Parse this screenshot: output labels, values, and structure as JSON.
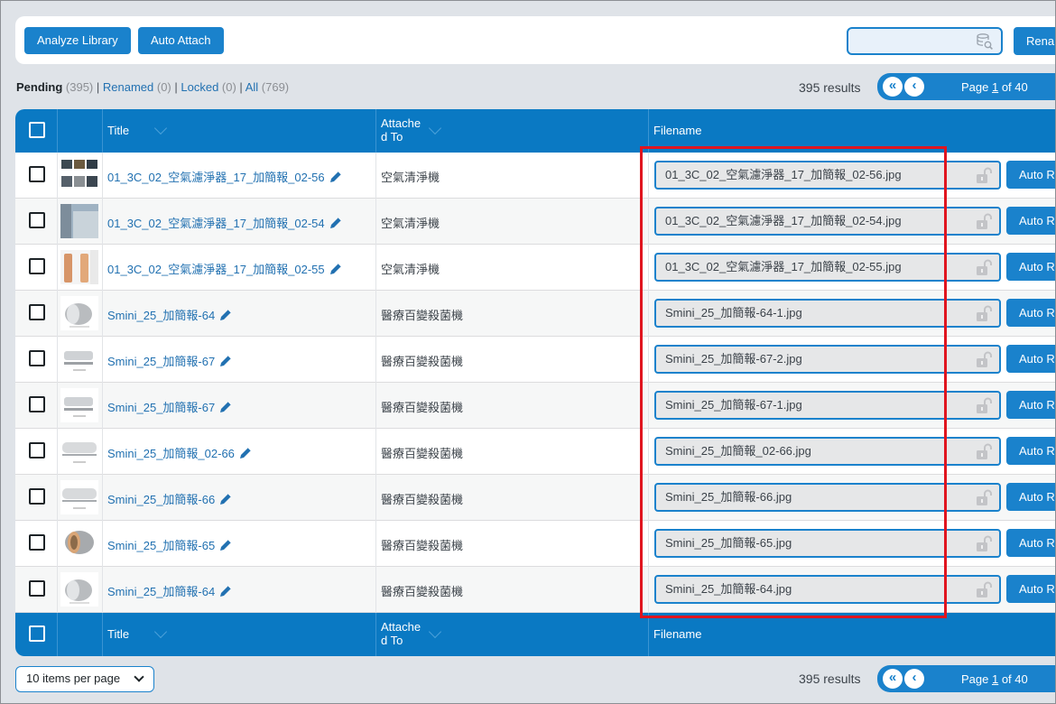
{
  "toolbar": {
    "analyze_label": "Analyze Library",
    "auto_attach_label": "Auto Attach",
    "search_value": "",
    "rename_label": "Rena"
  },
  "filters": {
    "pending_label": "Pending",
    "pending_count": "(395)",
    "sep1": " | ",
    "renamed_label": "Renamed",
    "renamed_count": "(0)",
    "sep2": " | ",
    "locked_label": "Locked",
    "locked_count": "(0)",
    "sep3": " | ",
    "all_label": "All",
    "all_count": "(769)"
  },
  "results_text": "395 results",
  "pagination": {
    "first_glyph": "«",
    "prev_glyph": "‹",
    "page_prefix": "Page ",
    "current_page": "1",
    "page_suffix": " of 40"
  },
  "columns": {
    "title": "Title",
    "attached_line1": "Attache",
    "attached_line2": "d To",
    "filename": "Filename"
  },
  "rows": [
    {
      "title": "01_3C_02_空氣濾淨器_17_加簡報_02-56",
      "attached": "空氣清淨機",
      "filename": "01_3C_02_空氣濾淨器_17_加簡報_02-56.jpg",
      "auto": "Auto R"
    },
    {
      "title": "01_3C_02_空氣濾淨器_17_加簡報_02-54",
      "attached": "空氣清淨機",
      "filename": "01_3C_02_空氣濾淨器_17_加簡報_02-54.jpg",
      "auto": "Auto R"
    },
    {
      "title": "01_3C_02_空氣濾淨器_17_加簡報_02-55",
      "attached": "空氣清淨機",
      "filename": "01_3C_02_空氣濾淨器_17_加簡報_02-55.jpg",
      "auto": "Auto R"
    },
    {
      "title": "Smini_25_加簡報-64",
      "attached": "醫療百變殺菌機",
      "filename": "Smini_25_加簡報-64-1.jpg",
      "auto": "Auto R"
    },
    {
      "title": "Smini_25_加簡報-67",
      "attached": "醫療百變殺菌機",
      "filename": "Smini_25_加簡報-67-2.jpg",
      "auto": "Auto R"
    },
    {
      "title": "Smini_25_加簡報-67",
      "attached": "醫療百變殺菌機",
      "filename": "Smini_25_加簡報-67-1.jpg",
      "auto": "Auto R"
    },
    {
      "title": "Smini_25_加簡報_02-66",
      "attached": "醫療百變殺菌機",
      "filename": "Smini_25_加簡報_02-66.jpg",
      "auto": "Auto R"
    },
    {
      "title": "Smini_25_加簡報-66",
      "attached": "醫療百變殺菌機",
      "filename": "Smini_25_加簡報-66.jpg",
      "auto": "Auto R"
    },
    {
      "title": "Smini_25_加簡報-65",
      "attached": "醫療百變殺菌機",
      "filename": "Smini_25_加簡報-65.jpg",
      "auto": "Auto R"
    },
    {
      "title": "Smini_25_加簡報-64",
      "attached": "醫療百變殺菌機",
      "filename": "Smini_25_加簡報-64.jpg",
      "auto": "Auto R"
    }
  ],
  "per_page_label": "10 items per page",
  "colors": {
    "accent": "#1a82cc",
    "header": "#0a79c3",
    "highlight": "#e0151f",
    "link": "#2271b1"
  }
}
